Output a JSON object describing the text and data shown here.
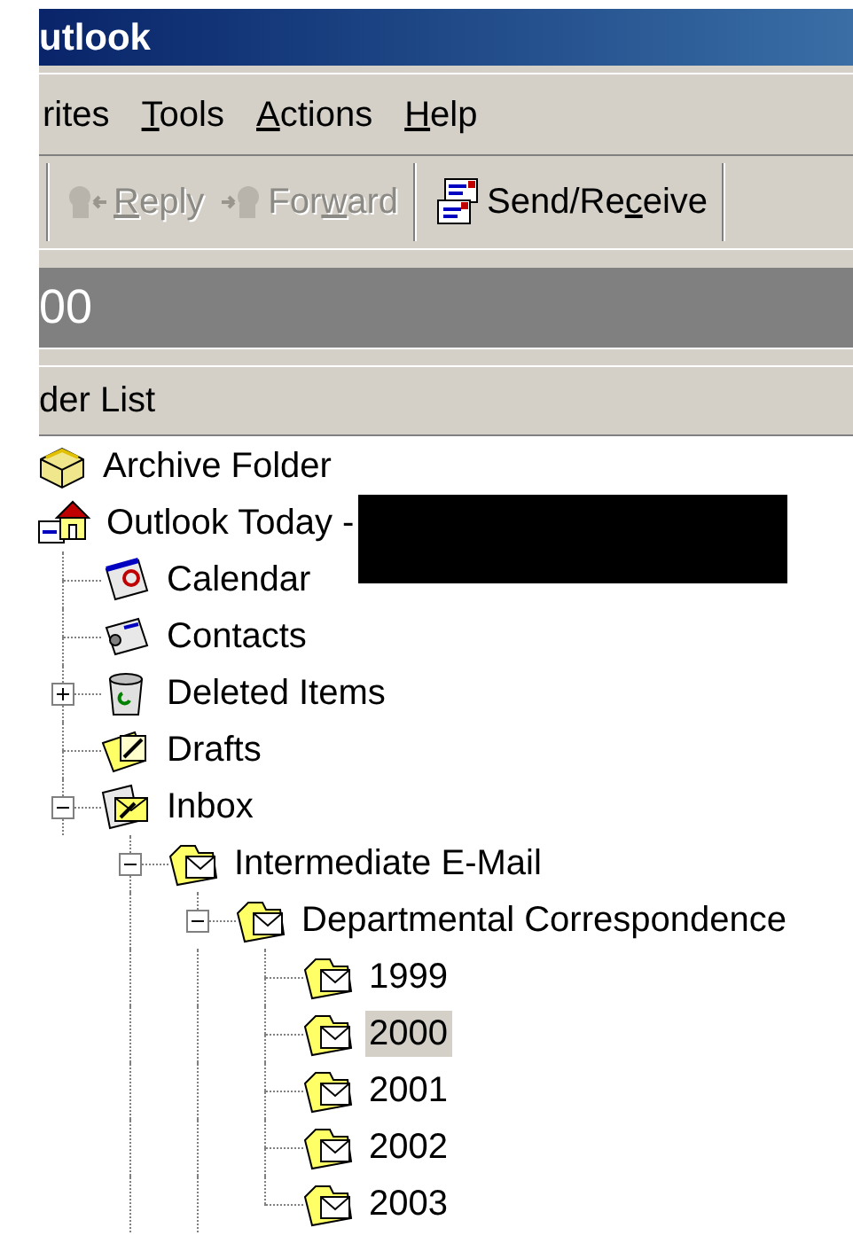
{
  "window": {
    "title": "utlook"
  },
  "menu": [
    {
      "before": "rites"
    },
    {
      "key": "T",
      "after": "ools"
    },
    {
      "key": "A",
      "after": "ctions"
    },
    {
      "key": "H",
      "after": "elp"
    }
  ],
  "toolbar": [
    {
      "kind": "reply",
      "key": "R",
      "after": "eply",
      "disabled": true
    },
    {
      "kind": "forward",
      "before": "For",
      "key": "w",
      "after": "ard",
      "disabled": true
    },
    {
      "kind": "send_receive",
      "before": "Send/Re",
      "key": "c",
      "after": "eive",
      "disabled": false
    }
  ],
  "folder_banner": "00",
  "folder_list": {
    "title": "der List"
  },
  "tree": [
    {
      "label": "Archive Folder",
      "kind": "archive",
      "selected": false
    },
    {
      "label": "Outlook Today -",
      "kind": "today",
      "selected": false,
      "redacted": true,
      "children": [
        {
          "label": "Calendar",
          "kind": "calendar",
          "selected": false
        },
        {
          "label": "Contacts",
          "kind": "contacts",
          "selected": false
        },
        {
          "label": "Deleted Items",
          "kind": "deleted",
          "selected": false,
          "expanded": false
        },
        {
          "label": "Drafts",
          "kind": "drafts",
          "selected": false
        },
        {
          "label": "Inbox",
          "kind": "inbox",
          "selected": false,
          "expanded": true,
          "continues": true,
          "children": [
            {
              "label": "Intermediate E-Mail",
              "kind": "mail_folder",
              "selected": false,
              "expanded": true,
              "continues": true,
              "children": [
                {
                  "label": "Departmental Correspondence",
                  "kind": "mail_folder",
                  "selected": false,
                  "expanded": true,
                  "children": [
                    {
                      "label": "1999",
                      "kind": "mail_folder",
                      "selected": false
                    },
                    {
                      "label": "2000",
                      "kind": "mail_folder",
                      "selected": true
                    },
                    {
                      "label": "2001",
                      "kind": "mail_folder",
                      "selected": false
                    },
                    {
                      "label": "2002",
                      "kind": "mail_folder",
                      "selected": false
                    },
                    {
                      "label": "2003",
                      "kind": "mail_folder",
                      "selected": false
                    }
                  ]
                }
              ]
            }
          ]
        }
      ]
    }
  ]
}
